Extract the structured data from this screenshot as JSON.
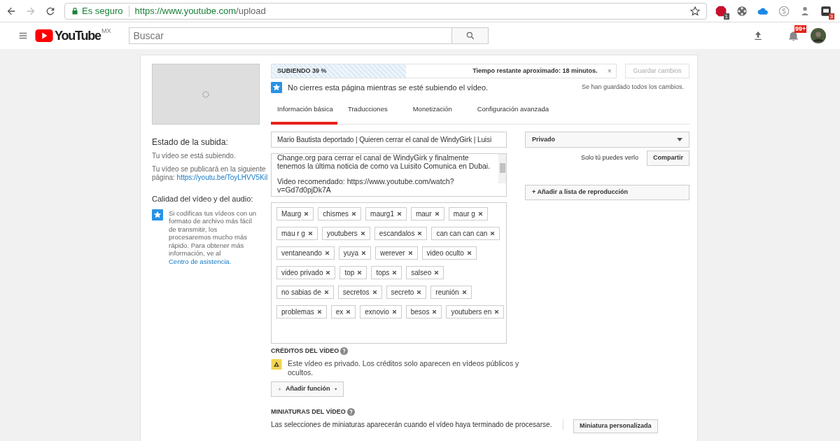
{
  "browser": {
    "security": "Es seguro",
    "url_host": "https://www.youtube.com",
    "url_path": "/upload",
    "extensions": [
      {
        "kind": "abp",
        "badge": "1"
      },
      {
        "kind": "reel"
      },
      {
        "kind": "cloud"
      },
      {
        "kind": "skype"
      },
      {
        "kind": "figure"
      },
      {
        "kind": "square",
        "badge": "3"
      }
    ]
  },
  "header": {
    "logo_text": "YouTube",
    "region": "MX",
    "search_placeholder": "Buscar",
    "notifications": "99+"
  },
  "upload": {
    "progress_label": "SUBIENDO 39 %",
    "level": 0.39,
    "remaining": "Tiempo restante aproximado: 18 minutos.",
    "close": "×",
    "save_button": {
      "label": "Guardar cambios",
      "disabled": true
    },
    "notice": "No cierres esta página mientras se esté subiendo el vídeo.",
    "saved_status": "Se han guardado todos los cambios."
  },
  "sidebar": {
    "status_title": "Estado de la subida:",
    "status_text": "Tu vídeo se está subiendo.",
    "publish_text": "Tu vídeo se publicará en la siguiente página:",
    "publish_link": "https://youtu.be/ToyLHVV5Kil",
    "quality_title": "Calidad del vídeo y del audio:",
    "quality_text": "Si codificas tus vídeos con un formato de archivo más fácil de transmitir, los procesaremos mucho más rápido. Para obtener más información, ve al",
    "help_link": "Centro de asistencia."
  },
  "tabs": [
    {
      "label": "Información básica",
      "selected": true
    },
    {
      "label": "Traducciones",
      "selected": false
    },
    {
      "label": "Monetización",
      "selected": false
    },
    {
      "label": "Configuración avanzada",
      "selected": false
    }
  ],
  "form": {
    "title": "Mario Bautista deportado | Quieren cerrar el canal de WindyGirk | Luisi",
    "description": [
      "Change.org para cerrar el canal de WindyGirk y finalmente tenemos la última noticia de como va Luisito Comunica en Dubai.",
      "Video recomendado: https://www.youtube.com/watch?v=Gd7d0pjDk7A"
    ],
    "tags": [
      "Maurg",
      "chismes",
      "maurg1",
      "maur",
      "maur g",
      "mau r g",
      "youtubers",
      "escandalos",
      "can can can can",
      "ventaneando",
      "yuya",
      "werever",
      "video oculto",
      "video privado",
      "top",
      "tops",
      "salseo",
      "no sabias de",
      "secretos",
      "secreto",
      "reunión",
      "problemas",
      "ex",
      "exnovio",
      "besos",
      "youtubers en"
    ],
    "privacy": "Privado",
    "privacy_note": "Solo tú puedes verlo",
    "share_button": "Compartir",
    "playlist_button": "+ Añadir a lista de reproducción"
  },
  "credits": {
    "title": "CRÉDITOS DEL VÍDEO",
    "warning": "Este vídeo es privado. Los créditos solo aparecen en vídeos públicos y ocultos.",
    "add_button": "Añadir función"
  },
  "thumbnails": {
    "title": "MINIATURAS DEL VÍDEO",
    "text": "Las selecciones de miniaturas aparecerán cuando el vídeo haya terminado de procesarse.",
    "custom_button": "Miniatura personalizada"
  }
}
